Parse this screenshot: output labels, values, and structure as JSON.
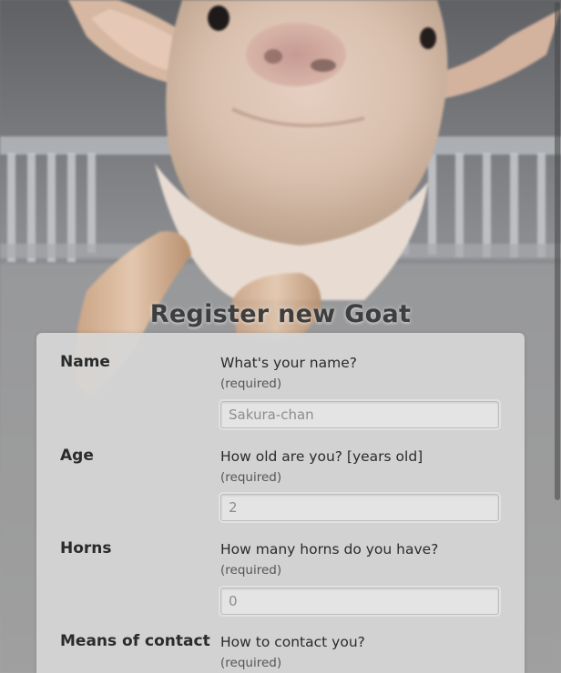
{
  "page": {
    "title": "Register new Goat"
  },
  "form": {
    "fields": [
      {
        "label": "Name",
        "question": "What's your name?",
        "required": "(required)",
        "placeholder": "Sakura-chan"
      },
      {
        "label": "Age",
        "question": "How old are you? [years old]",
        "required": "(required)",
        "placeholder": "2"
      },
      {
        "label": "Horns",
        "question": "How many horns do you have?",
        "required": "(required)",
        "placeholder": "0"
      },
      {
        "label": "Means of contact",
        "question": "How to contact you?",
        "required": "(required)"
      }
    ]
  },
  "colors": {
    "card_background": "#d6d6d6",
    "input_background": "#e4e4e4",
    "title_text": "#3e3e3e"
  },
  "scrollbar": {
    "visible_fraction": 0.74
  }
}
